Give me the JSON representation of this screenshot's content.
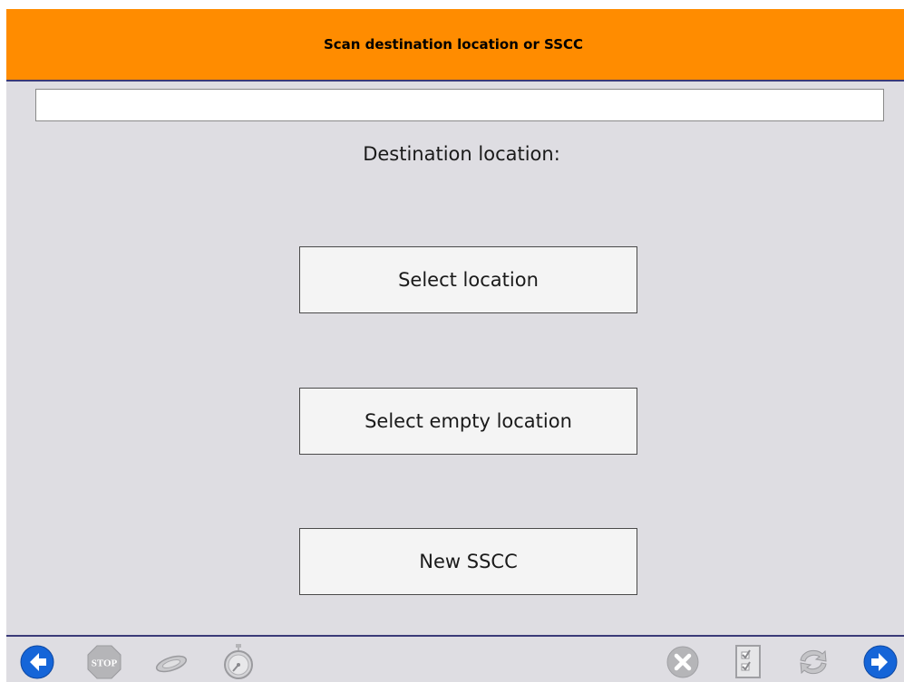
{
  "header": {
    "title": "Scan destination location or SSCC"
  },
  "scan_field": {
    "value": "",
    "placeholder": ""
  },
  "destination": {
    "label": "Destination location:"
  },
  "buttons": {
    "select_location": "Select location",
    "select_empty_location": "Select empty location",
    "new_sscc": "New SSCC"
  },
  "toolbar": {
    "stop_label": "STOP",
    "left_icons": [
      "back-arrow-icon",
      "stop-icon",
      "scanner-icon",
      "stopwatch-icon"
    ],
    "right_icons": [
      "cancel-icon",
      "checklist-icon",
      "refresh-icon",
      "forward-arrow-icon"
    ]
  },
  "colors": {
    "header_bg": "#ff8c00",
    "body_bg": "#dedde2",
    "divider": "#3a3a78",
    "nav_blue": "#1565d8",
    "disabled_gray": "#b5b5b8"
  }
}
